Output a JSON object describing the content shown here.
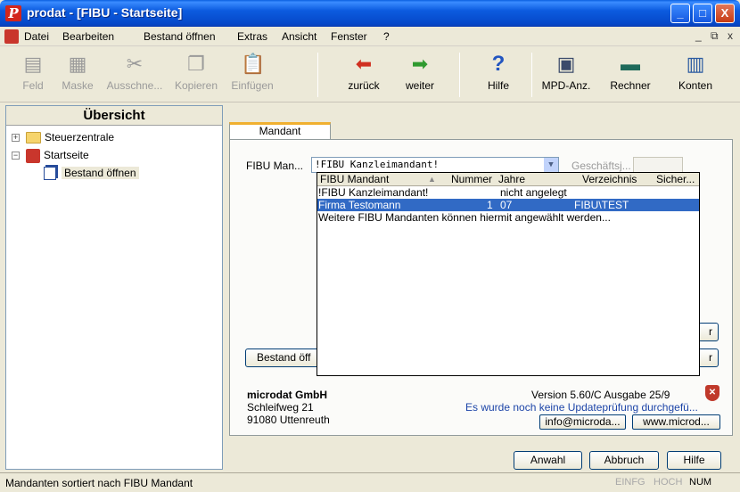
{
  "window": {
    "title": "prodat - [FIBU - Startseite]",
    "app_icon_letter": "P",
    "min_glyph": "_",
    "max_glyph": "□",
    "close_glyph": "X"
  },
  "menubar": {
    "items": [
      "Datei",
      "Bearbeiten",
      "Bestand öffnen",
      "Extras",
      "Ansicht",
      "Fenster",
      "?"
    ],
    "mdi_min": "_",
    "mdi_restore": "⧉",
    "mdi_close": "x"
  },
  "toolbar": {
    "buttons": [
      {
        "label": "Feld",
        "icon": "field-icon",
        "glyph": "▤"
      },
      {
        "label": "Maske",
        "icon": "mask-icon",
        "glyph": "▦"
      },
      {
        "label": "Ausschne...",
        "icon": "scissors-icon",
        "glyph": "✂"
      },
      {
        "label": "Kopieren",
        "icon": "copy-icon",
        "glyph": "❐"
      },
      {
        "label": "Einfügen",
        "icon": "paste-icon",
        "glyph": "📋"
      },
      {
        "label": "zurück",
        "icon": "back-arrow-icon",
        "glyph": "⬅"
      },
      {
        "label": "weiter",
        "icon": "forward-arrow-icon",
        "glyph": "➡"
      },
      {
        "label": "Hilfe",
        "icon": "help-icon",
        "glyph": "?"
      },
      {
        "label": "MPD-Anz.",
        "icon": "mpd-display-icon",
        "glyph": "▣"
      },
      {
        "label": "Rechner",
        "icon": "calculator-icon",
        "glyph": "▬"
      },
      {
        "label": "Konten",
        "icon": "accounts-icon",
        "glyph": "▥"
      }
    ]
  },
  "sidebar": {
    "title": "Übersicht",
    "items": [
      {
        "label": "Steuerzentrale",
        "expander": "+"
      },
      {
        "label": "Startseite",
        "expander": "−"
      },
      {
        "label": "Bestand öffnen"
      }
    ]
  },
  "main": {
    "tab_label": "Mandant",
    "fibu_label": "FIBU Man...",
    "fibu_value": "!FIBU Kanzleimandant!",
    "geschaeft_label": "Geschäftsj...",
    "dropdown": {
      "columns": [
        "FIBU Mandant",
        "Nummer",
        "Jahre",
        "Verzeichnis",
        "Sicher..."
      ],
      "rows": [
        {
          "mandant": "!FIBU Kanzleimandant!",
          "nummer": "",
          "jahre": "nicht angelegt",
          "verzeichnis": ""
        },
        {
          "mandant": "Firma Testomann",
          "nummer": "1",
          "jahre": "07",
          "verzeichnis": "FIBU\\TEST"
        },
        {
          "mandant": "Weitere FIBU Mandanten können hiermit angewählt werden...",
          "nummer": "",
          "jahre": "",
          "verzeichnis": ""
        }
      ]
    },
    "bestand_button": "Bestand öff",
    "side_btn_1": "r",
    "side_btn_2": "r",
    "company": {
      "name": "microdat GmbH",
      "street": "Schleifweg 21",
      "city": "91080 Uttenreuth"
    },
    "version": "Version 5.60/C Ausgabe 25/9",
    "update_note": "Es wurde noch keine Updateprüfung durchgefü...",
    "email_btn": "info@microda...",
    "web_btn": "www.microd..."
  },
  "footer_buttons": {
    "anwahl": "Anwahl",
    "abbruch": "Abbruch",
    "hilfe": "Hilfe"
  },
  "statusbar": {
    "text": "Mandanten sortiert nach FIBU Mandant",
    "einfg": "EINFG",
    "hoch": "HOCH",
    "num": "NUM"
  }
}
